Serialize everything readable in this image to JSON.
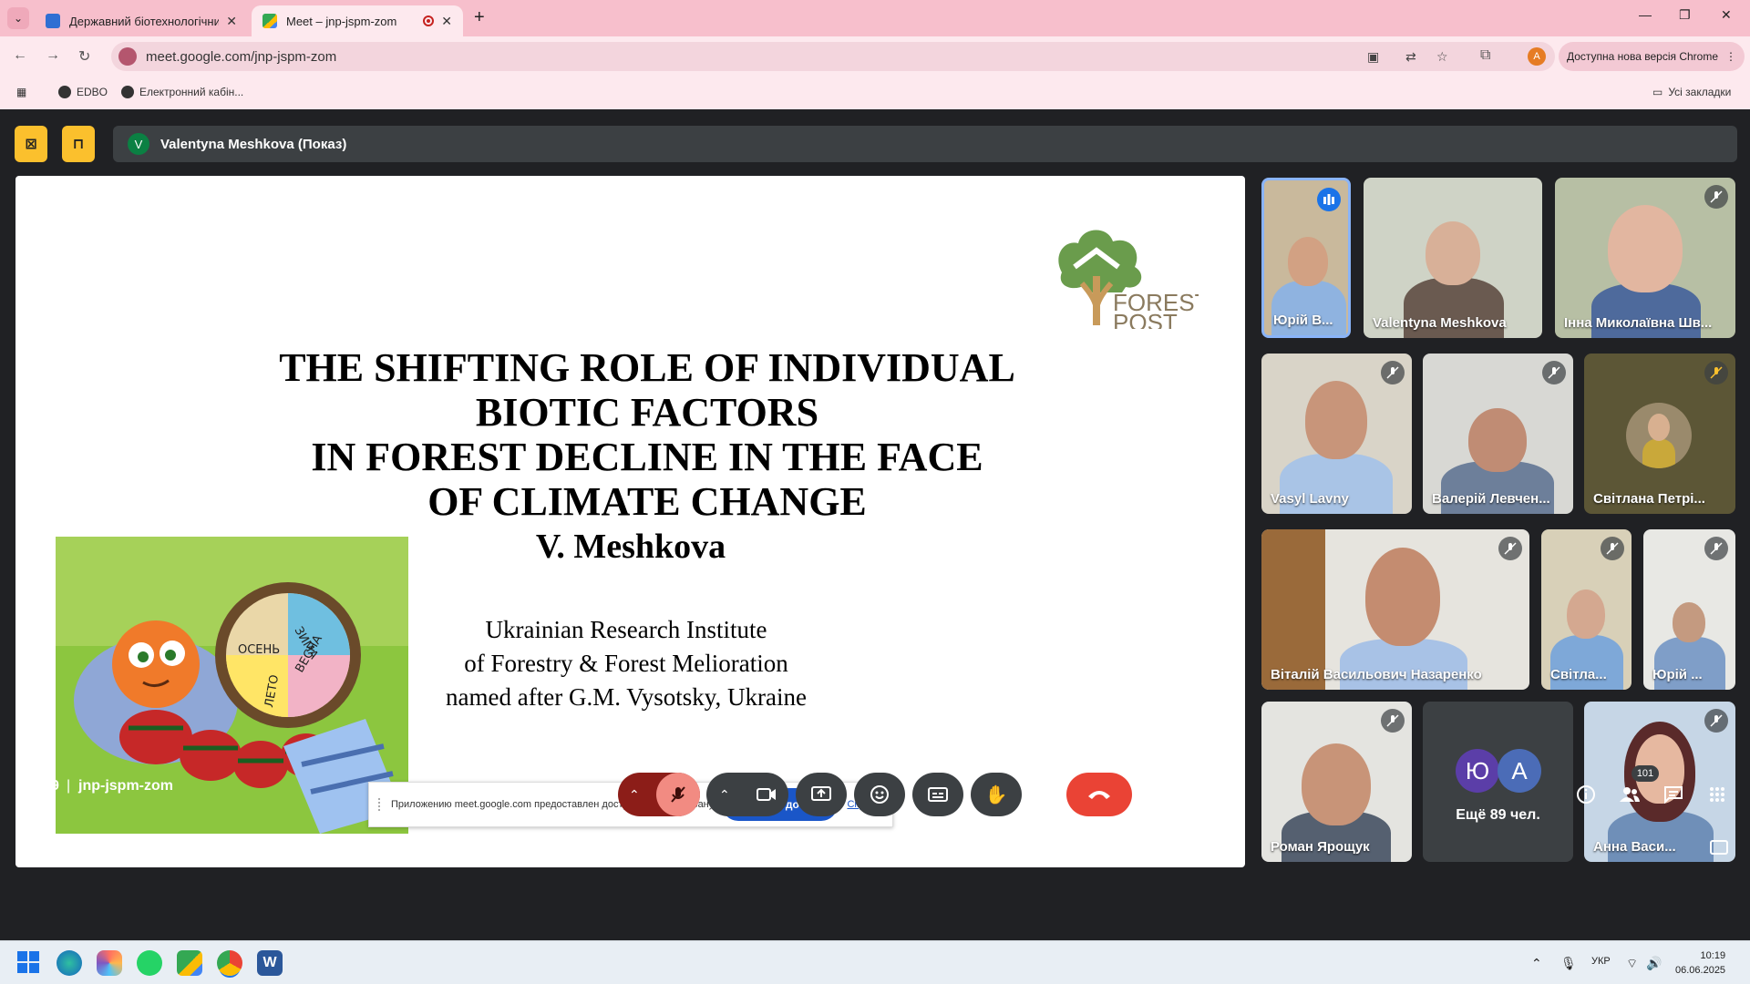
{
  "browser": {
    "tabs": [
      {
        "title": "Державний біотехнологічний",
        "active": false
      },
      {
        "title": "Meet – jnp-jspm-zom",
        "active": true
      }
    ],
    "url": "meet.google.com/jnp-jspm-zom",
    "update_label": "Доступна нова версія Chrome",
    "profile_initial": "A",
    "bookmarks": [
      "EDBO",
      "Електронний кабін..."
    ],
    "all_bookmarks_label": "Усі закладки"
  },
  "meet": {
    "presenter_initial": "V",
    "presenter_label": "Valentyna Meshkova (Показ)",
    "slide": {
      "title_lines": [
        "THE SHIFTING ROLE OF INDIVIDUAL",
        "BIOTIC FACTORS",
        "IN FOREST DECLINE IN THE FACE",
        "OF CLIMATE CHANGE"
      ],
      "author": "V. Meshkova",
      "institute_lines": [
        "Ukrainian Research Institute",
        "of Forestry & Forest Melioration",
        "named after G.M. Vysotsky, Ukraine"
      ],
      "logo_lines": [
        "FOREST",
        "POST"
      ],
      "wheel_labels": [
        "ЗИМА",
        "ВЕСНА",
        "ЛЕТО",
        "ОСЕНЬ"
      ]
    },
    "share_notice": {
      "message": "Приложению meet.google.com предоставлен доступ к вашему экрану.",
      "stop_label": "Закрыть доступ",
      "hide_label": "Скрыть"
    },
    "participants": [
      {
        "name": "Юрій В...",
        "state": "speaking"
      },
      {
        "name": "Valentyna Meshkova",
        "state": "active"
      },
      {
        "name": "Інна Миколаївна Шв...",
        "state": "muted"
      },
      {
        "name": "Vasyl Lavny",
        "state": "muted"
      },
      {
        "name": "Валерій Левчен...",
        "state": "muted"
      },
      {
        "name": "Світлана Петрі...",
        "state": "muted"
      },
      {
        "name": "Віталій Васильович Назаренко",
        "state": "muted"
      },
      {
        "name": "Світла...",
        "state": "muted"
      },
      {
        "name": "Юрій ...",
        "state": "muted"
      },
      {
        "name": "Роман Ярощук",
        "state": "muted"
      },
      {
        "name": "Анна Васи...",
        "state": "muted"
      }
    ],
    "more_people": {
      "initials": [
        "Ю",
        "А"
      ],
      "label": "Ещё 89 чел."
    },
    "bottom": {
      "time": "10:19",
      "meeting_code": "jnp-jspm-zom",
      "people_count": "101"
    }
  },
  "taskbar": {
    "language": "УКР",
    "time": "10:19",
    "date": "06.06.2025"
  },
  "colors": {
    "chrome_frame": "#f7bfcc",
    "meet_bg": "#202124",
    "tile_bg": "#3c4043",
    "end_call": "#ea4335",
    "mic_off": "#f28b82",
    "accent_yellow": "#fbc02d"
  }
}
